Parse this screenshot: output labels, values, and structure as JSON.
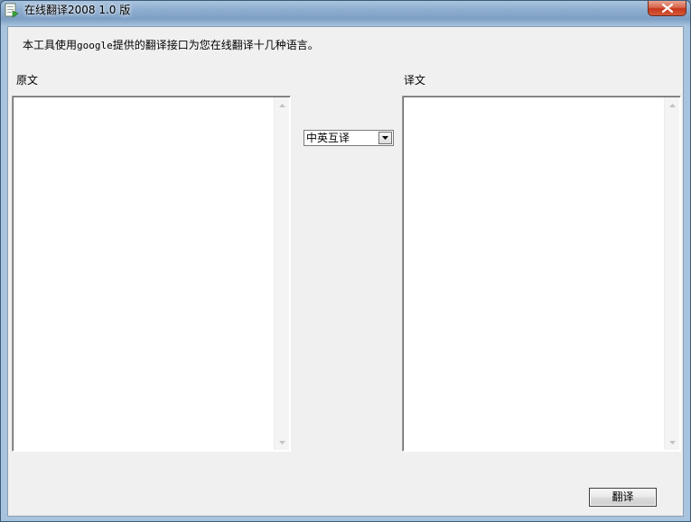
{
  "window": {
    "title": "在线翻译2008 1.0 版"
  },
  "content": {
    "description_prefix": "本工具使用",
    "description_api": "google",
    "description_suffix": "提供的翻译接口为您在线翻译十几种语言。",
    "source_label": "原文",
    "target_label": "译文",
    "source_text": "",
    "target_text": ""
  },
  "mode_select": {
    "selected": "中英互译"
  },
  "actions": {
    "translate_label": "翻译"
  },
  "colors": {
    "titlebar_accent": "#7d9fc5",
    "close_button": "#c7361b",
    "dialog_bg": "#f0f0f0"
  }
}
